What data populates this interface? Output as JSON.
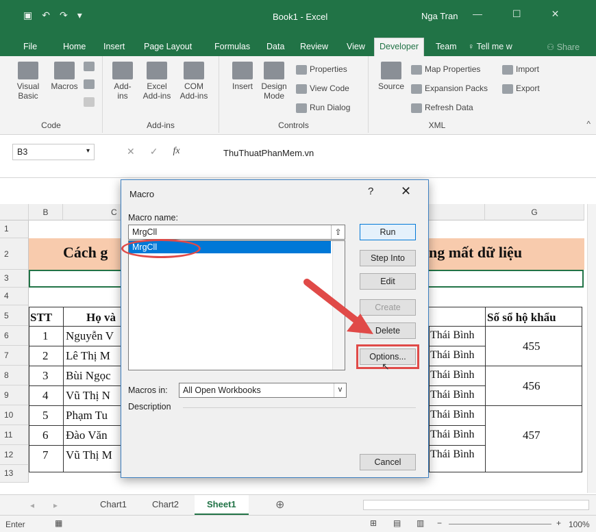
{
  "app": {
    "window_title": "Book1 - Excel",
    "user": "Nga Tran"
  },
  "tabs": [
    "File",
    "Home",
    "Insert",
    "Page Layout",
    "Formulas",
    "Data",
    "Review",
    "View",
    "Developer",
    "Team",
    "Tell me w",
    "Share"
  ],
  "ribbon": {
    "code": {
      "label": "Code",
      "visual_basic": "Visual Basic",
      "macros": "Macros"
    },
    "addins": {
      "label": "Add-ins",
      "addins": "Add-ins",
      "excel_addins": "Excel Add-ins",
      "com_addins": "COM Add-ins"
    },
    "controls": {
      "label": "Controls",
      "insert": "Insert",
      "design_mode": "Design Mode",
      "properties": "Properties",
      "view_code": "View Code",
      "run_dialog": "Run Dialog"
    },
    "xml": {
      "label": "XML",
      "source": "Source",
      "map_properties": "Map Properties",
      "expansion_packs": "Expansion Packs",
      "refresh_data": "Refresh Data",
      "import": "Import",
      "export": "Export"
    }
  },
  "formula_bar": {
    "name_box": "B3",
    "fx": "fx",
    "content": "ThuThuatPhanMem.vn"
  },
  "columns": [
    "B",
    "C",
    "G"
  ],
  "rows": [
    "1",
    "2",
    "3",
    "4",
    "5",
    "6",
    "7",
    "8",
    "9",
    "10",
    "11",
    "12",
    "13"
  ],
  "sheet": {
    "title_left": "Cách g",
    "title_right": "ng mất dữ liệu",
    "headers": {
      "stt": "STT",
      "name": "Họ và",
      "ho_khau": "Số sổ hộ khẩu"
    },
    "rows": [
      {
        "stt": "1",
        "name": "Nguyễn V",
        "place": "Thái Bình"
      },
      {
        "stt": "2",
        "name": "Lê Thị M",
        "place": "Thái Bình"
      },
      {
        "stt": "3",
        "name": "Bùi Ngọc",
        "place": "Thái Bình"
      },
      {
        "stt": "4",
        "name": "Vũ Thị N",
        "place": "Thái Bình"
      },
      {
        "stt": "5",
        "name": "Phạm Tu",
        "place": "Thái Bình"
      },
      {
        "stt": "6",
        "name": "Đào Văn",
        "place": "Thái Bình"
      },
      {
        "stt": "7",
        "name": "Vũ Thị M",
        "place": "Thái Bình"
      }
    ],
    "ho_khau_values": [
      "455",
      "456",
      "457"
    ]
  },
  "sheet_tabs": [
    "Chart1",
    "Chart2",
    "Sheet1"
  ],
  "status": {
    "mode": "Enter",
    "zoom": "100%"
  },
  "dialog": {
    "title": "Macro",
    "help": "?",
    "close": "✕",
    "macro_name_label": "Macro name:",
    "macro_name_value": "MrgCll",
    "list_items": [
      "MrgCll"
    ],
    "macros_in_label": "Macros in:",
    "macros_in_value": "All Open Workbooks",
    "description_label": "Description",
    "buttons": {
      "run": "Run",
      "step_into": "Step Into",
      "edit": "Edit",
      "create": "Create",
      "delete": "Delete",
      "options": "Options...",
      "cancel": "Cancel"
    }
  },
  "colors": {
    "excel_green": "#217346",
    "highlight_red": "#e04a48",
    "selection_blue": "#0078d7",
    "title_row_fill": "#f8cbad"
  }
}
